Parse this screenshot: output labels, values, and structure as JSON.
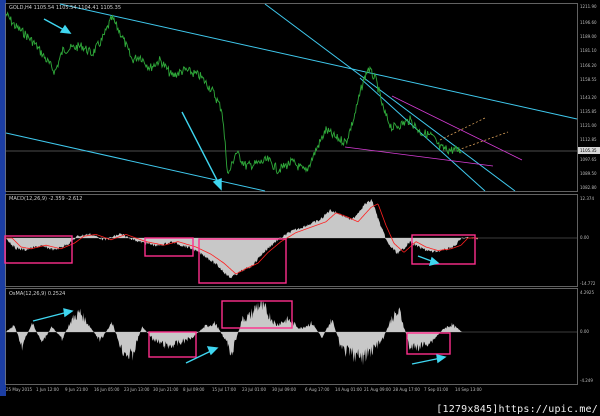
{
  "chart_data": [
    {
      "type": "line",
      "series": [],
      "label": "GOLD,H4  1105.54 1105.54 1104.41 1105.35",
      "price_ticks": [
        "1211.90",
        "1196.60",
        "1189.00",
        "1181.10",
        "1166.20",
        "1158.55",
        "1143.20",
        "1135.85",
        "1121.00",
        "1112.85",
        "1105.35",
        "1097.65",
        "1089.50",
        "1082.80"
      ],
      "current_price": "1105.35",
      "colors": {
        "price": "#2fa93a",
        "channel": "#3fc9ee",
        "magenta": "#d93dd8",
        "dashed": "#d9a05a",
        "arrow": "#3fd6f0",
        "box": "#ff2f8c"
      }
    },
    {
      "type": "area",
      "label": "MACD(12,26,9) -2.359 -2.612",
      "yticks": [
        "12.374",
        "0.00",
        "-14.772"
      ],
      "colors": {
        "hist": "#c8c8c8",
        "signal": "#ff2020"
      }
    },
    {
      "type": "area",
      "label": "OsMA(12,26,9) 0.2524",
      "yticks": [
        "4.2925",
        "0.00",
        "-4.249"
      ],
      "colors": {
        "hist": "#c8c8c8"
      }
    }
  ],
  "dates": [
    "25 May 2015",
    "1 Jun 12:00",
    "9 Jun 21:00",
    "16 Jun 05:00",
    "23 Jun 13:00",
    "30 Jun 21:00",
    "8 Jul 09:00",
    "15 Jul 17:00",
    "23 Jul 01:00",
    "30 Jul 09:00",
    "6 Aug 17:00",
    "14 Aug 01:00",
    "21 Aug 09:00",
    "28 Aug 17:00",
    "7 Sep 01:00",
    "14 Sep 13:00"
  ],
  "watermark": "[1279x845]https://upic.me/"
}
